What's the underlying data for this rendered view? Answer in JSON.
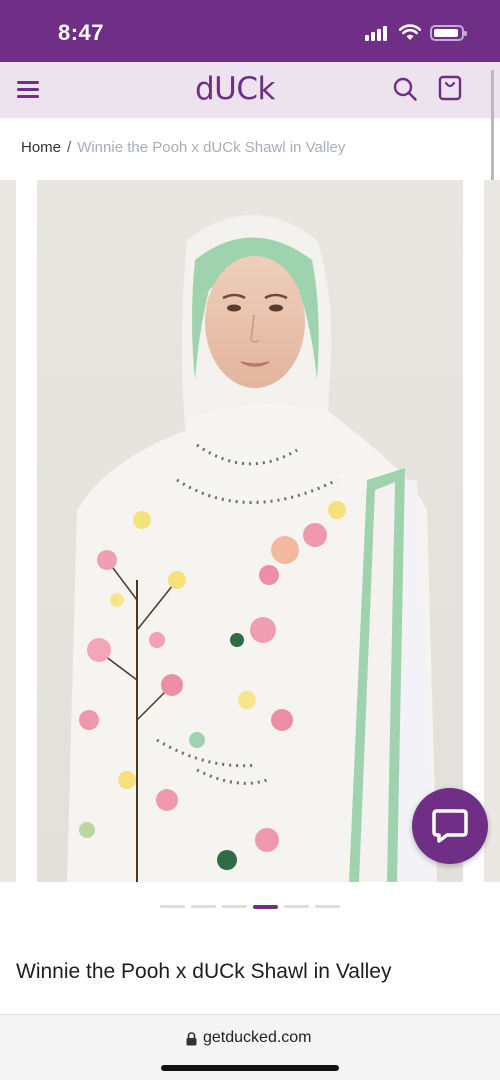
{
  "status_bar": {
    "time": "8:47"
  },
  "header": {
    "logo": "dUCk"
  },
  "breadcrumb": {
    "home": "Home",
    "separator": "/",
    "current": "Winnie the Pooh x dUCk Shawl in Valley"
  },
  "gallery": {
    "slide_count": 6,
    "active_index": 3
  },
  "product": {
    "title": "Winnie the Pooh x dUCk Shawl in Valley"
  },
  "browser": {
    "url": "getducked.com"
  },
  "colors": {
    "brand": "#6f2f87",
    "header_bg": "#ece3ef",
    "accent_green": "#9fd3ad"
  },
  "icons": [
    "menu-icon",
    "search-icon",
    "shopping-bag-icon",
    "chat-icon",
    "lock-icon"
  ]
}
